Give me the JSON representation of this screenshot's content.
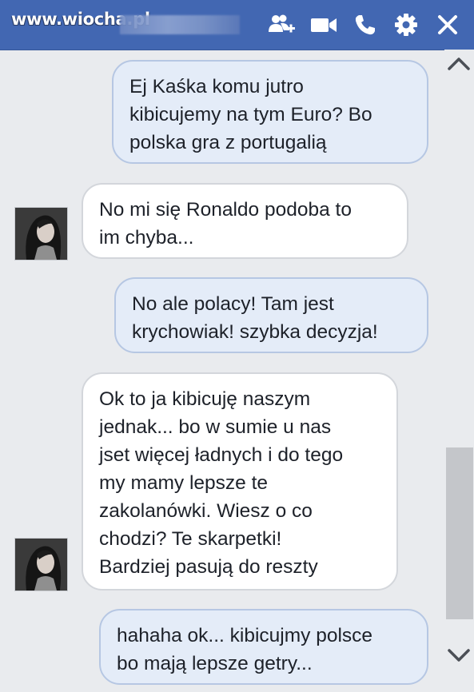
{
  "header": {
    "watermark": "www.wiocha.pl",
    "accent_color": "#4267b2",
    "icons": [
      "add-friend-icon",
      "video-call-icon",
      "phone-icon",
      "gear-icon",
      "close-icon"
    ]
  },
  "messages": [
    {
      "direction": "outgoing",
      "text": "Ej Kaśka komu jutro\nkibicujemy na tym Euro? Bo\npolska gra z portugalią"
    },
    {
      "direction": "incoming",
      "text": "No mi się Ronaldo podoba to\nim chyba..."
    },
    {
      "direction": "outgoing",
      "text": "No ale polacy! Tam jest\nkrychowiak! szybka decyzja!"
    },
    {
      "direction": "incoming",
      "text": "Ok to ja kibicuję naszym\njednak... bo w sumie u nas\njset więcej ładnych i do tego\nmy mamy lepsze te\nzakolanówki. Wiesz o co\nchodzi? Te skarpetki!\nBardziej pasują do reszty"
    },
    {
      "direction": "outgoing",
      "text": "hahaha ok... kibicujmy polsce\nbo mają lepsze getry..."
    }
  ]
}
